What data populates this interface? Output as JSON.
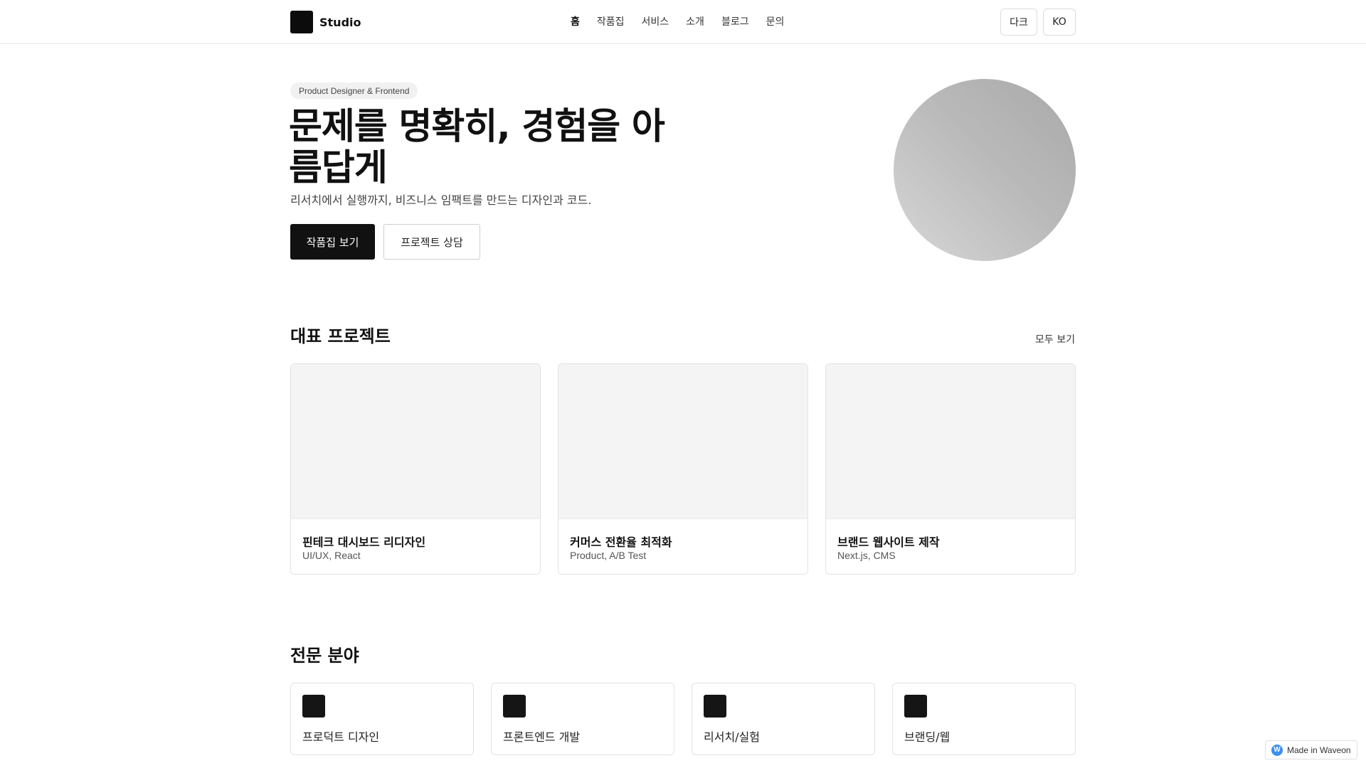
{
  "header": {
    "brand": "Studio",
    "nav": [
      "홈",
      "작품집",
      "서비스",
      "소개",
      "블로그",
      "문의"
    ],
    "theme_button": "다크",
    "lang_button": "KO"
  },
  "hero": {
    "badge": "Product Designer & Frontend",
    "title": "문제를 명확히, 경험을 아름답게",
    "subtitle": "리서치에서 실행까지, 비즈니스 임팩트를 만드는 디자인과 코드.",
    "primary_cta": "작품집 보기",
    "secondary_cta": "프로젝트 상담"
  },
  "featured": {
    "title": "대표 프로젝트",
    "see_all": "모두 보기",
    "projects": [
      {
        "title": "핀테크 대시보드 리디자인",
        "tags": "UI/UX, React"
      },
      {
        "title": "커머스 전환율 최적화",
        "tags": "Product, A/B Test"
      },
      {
        "title": "브랜드 웹사이트 제작",
        "tags": "Next.js, CMS"
      }
    ]
  },
  "expertise": {
    "title": "전문 분야",
    "items": [
      "프로덕트 디자인",
      "프론트엔드 개발",
      "리서치/실험",
      "브랜딩/웹"
    ]
  },
  "made_in": {
    "label": "Made in Waveon",
    "icon": "waveon-logo-icon",
    "icon_letter": "W",
    "icon_color": "#3d8ff0"
  }
}
